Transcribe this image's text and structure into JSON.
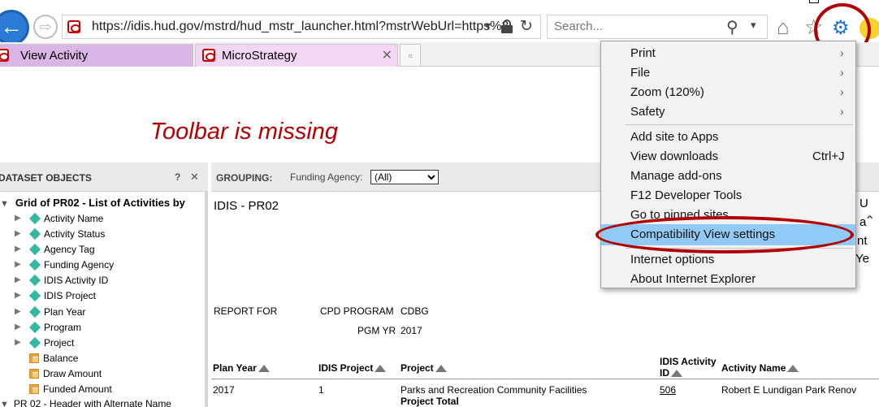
{
  "browser": {
    "url": "https://idis.hud.gov/mstrd/hud_mstr_launcher.html?mstrWebUrl=https%3",
    "search_placeholder": "Search...",
    "icons": [
      "back-arrow-icon",
      "forward-arrow-icon",
      "site-favicon",
      "lock-icon",
      "refresh-icon",
      "search-icon",
      "home-icon",
      "star-icon",
      "gear-icon",
      "smiley-icon"
    ]
  },
  "tabs": [
    {
      "label": "View Activity"
    },
    {
      "label": "MicroStrategy",
      "close": "✕"
    }
  ],
  "annotation": {
    "note": "Toolbar is missing"
  },
  "dataset_panel": {
    "title": "DATASET OBJECTS",
    "help": "?",
    "close": "✕",
    "grid_name": "Grid of PR02 - List of Activities by",
    "attributes": [
      "Activity Name",
      "Activity Status",
      "Agency Tag",
      "Funding Agency",
      "IDIS Activity ID",
      "IDIS Project",
      "Plan Year",
      "Program",
      "Project"
    ],
    "metrics": [
      "Balance",
      "Draw Amount",
      "Funded Amount"
    ],
    "next_dataset": "PR 02 - Header with Alternate Name"
  },
  "grouping": {
    "label": "GROUPING:",
    "funding_label": "Funding Agency:",
    "funding_value": "(All)"
  },
  "report": {
    "title": "IDIS - PR02",
    "report_for": "REPORT FOR",
    "cpd_program": "CPD PROGRAM",
    "program_value": "CDBG",
    "pgm_yr": "PGM YR",
    "year_value": "2017",
    "columns": {
      "plan_year": "Plan Year",
      "idis_project": "IDIS Project",
      "project": "Project",
      "activity_id_1": "IDIS Activity",
      "activity_id_2": "ID",
      "activity_name": "Activity Name"
    },
    "row": {
      "plan_year": "2017",
      "idis_project": "1",
      "project": "Parks and Recreation Community Facilities",
      "activity_id": "506",
      "activity_name": "Robert E Lundigan Park Renov"
    },
    "project_total": "Project Total"
  },
  "tools_menu": {
    "print": "Print",
    "file": "File",
    "zoom": "Zoom (120%)",
    "safety": "Safety",
    "add_site": "Add site to Apps",
    "view_downloads": "View downloads",
    "view_downloads_shortcut": "Ctrl+J",
    "manage_addons": "Manage add-ons",
    "f12": "F12 Developer Tools",
    "pinned": "Go to pinned sites",
    "compat": "Compatibility View settings",
    "internet_options": "Internet options",
    "about": "About Internet Explorer"
  },
  "edge_fragments": [
    "U",
    "a",
    "nt",
    "Ye"
  ]
}
